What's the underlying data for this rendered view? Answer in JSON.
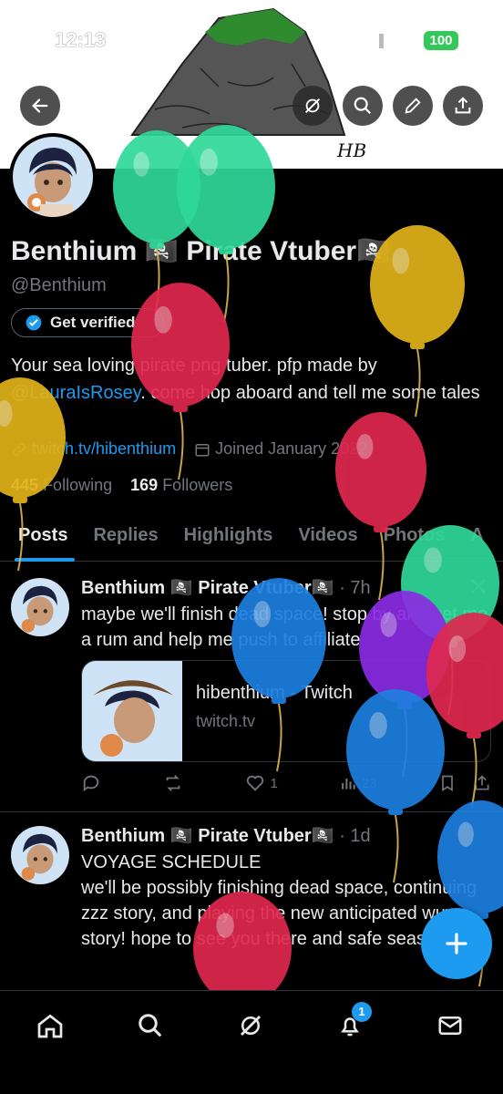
{
  "status_bar": {
    "time": "12:13",
    "battery": "100"
  },
  "banner": {
    "signature": "HB"
  },
  "profile": {
    "display_name": "Benthium 🏴‍☠️ Pirate Vtuber🏴‍☠️",
    "handle": "@Benthium",
    "verify_button": "Get verified",
    "bio_part1": "Your sea loving pirate png tuber. pfp made by ",
    "bio_mention": "@LauraIsRosey",
    "bio_part2": ". come hop aboard and tell me some tales",
    "link": "twitch.tv/hibenthium",
    "joined": "Joined January 2022",
    "following_count": "445",
    "following_label": "Following",
    "followers_count": "169",
    "followers_label": "Followers"
  },
  "tabs": [
    "Posts",
    "Replies",
    "Highlights",
    "Videos",
    "Photos",
    "A"
  ],
  "posts": [
    {
      "author": "Benthium 🏴‍☠️ Pirate Vtuber🏴‍☠️",
      "time": "· 7h",
      "text": "maybe we'll finish dead space! stop by and get me a rum and help me push to affiliate",
      "card_title": "hibenthium - Twitch",
      "card_domain": "twitch.tv",
      "likes": "1",
      "views": "23"
    },
    {
      "author": "Benthium 🏴‍☠️ Pirate Vtuber🏴‍☠️",
      "time": "· 1d",
      "line1": "VOYAGE SCHEDULE",
      "text": "we'll be possibly finishing dead space, continuing zzz story, and playing the new anticipated wuwa story! hope to see you there and safe seas!"
    }
  ],
  "bottom_nav": {
    "notification_badge": "1"
  },
  "colors": {
    "accent": "#1d9bf0",
    "background": "#000000",
    "muted": "#71767b"
  },
  "icons": [
    "back-arrow-icon",
    "grok-icon",
    "search-icon",
    "edit-icon",
    "share-icon",
    "verified-badge-icon",
    "link-icon",
    "calendar-icon",
    "reply-icon",
    "repost-icon",
    "like-icon",
    "views-icon",
    "bookmark-icon",
    "x-logo-icon",
    "home-icon",
    "notifications-icon",
    "messages-icon",
    "compose-plus-icon"
  ]
}
